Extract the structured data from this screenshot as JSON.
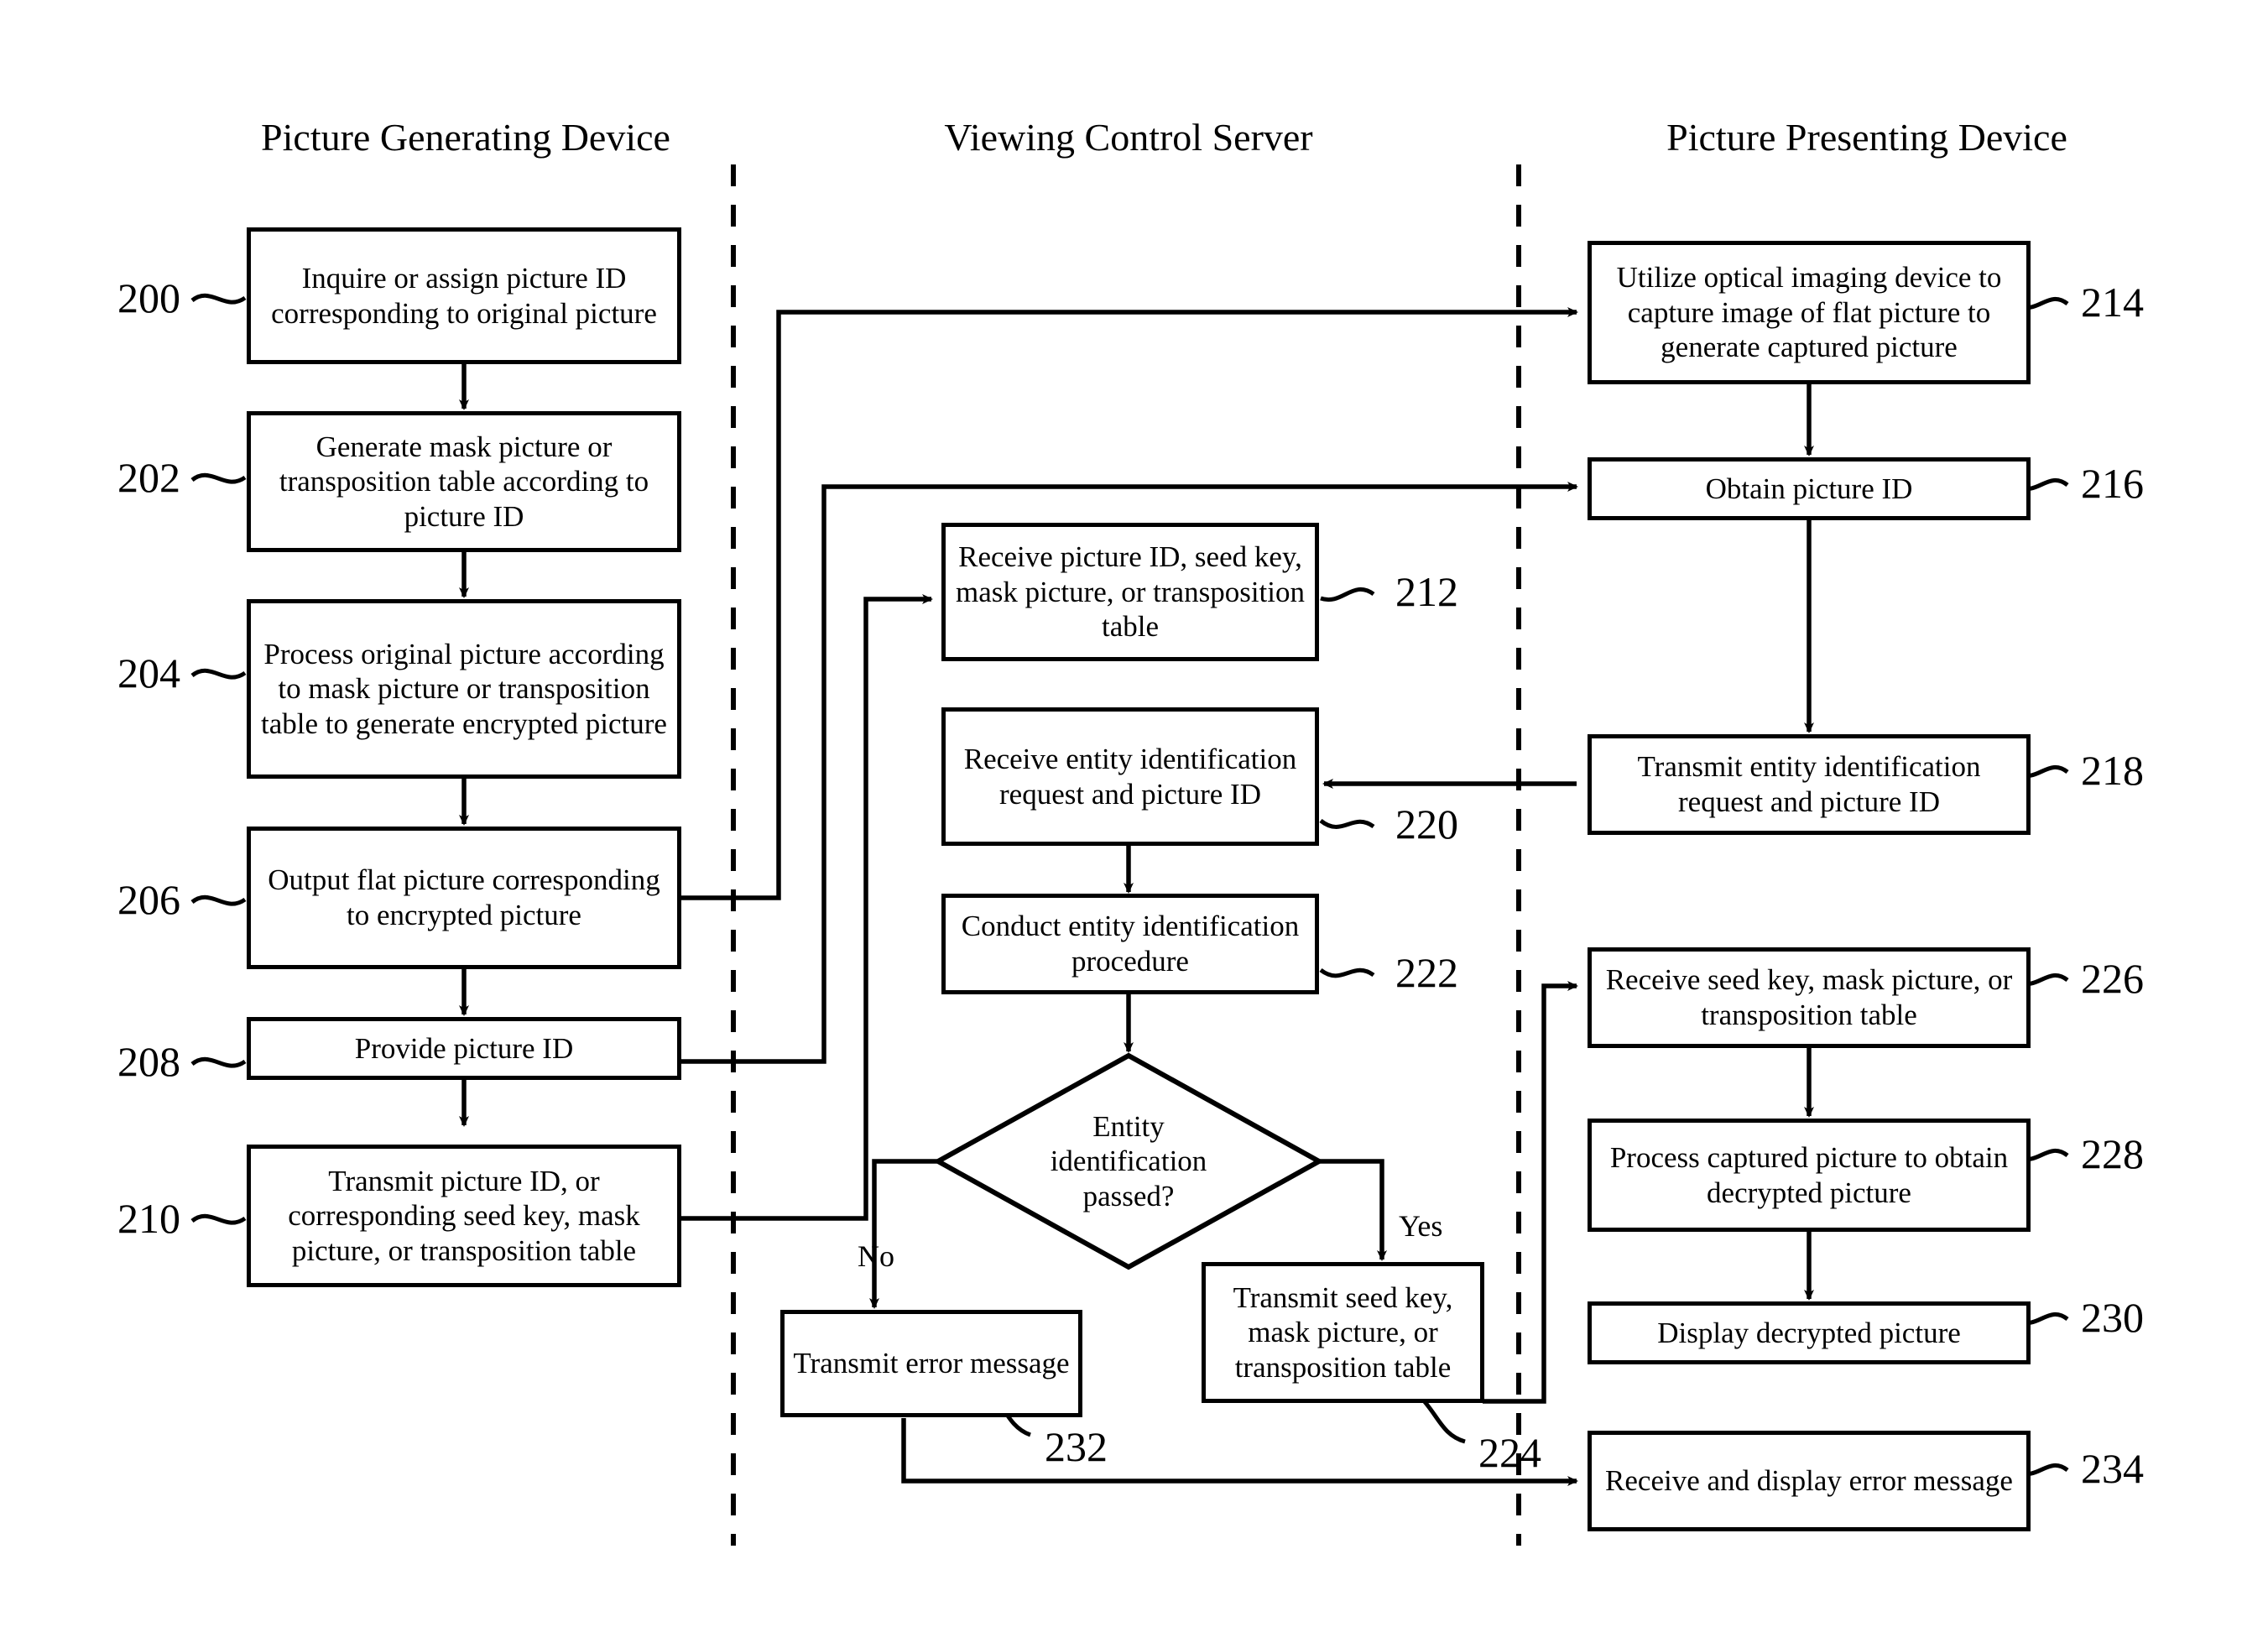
{
  "figure": {
    "lanes": [
      {
        "id": "picture-generating-device",
        "title": "Picture Generating Device"
      },
      {
        "id": "viewing-control-server",
        "title": "Viewing Control Server"
      },
      {
        "id": "picture-presenting-device",
        "title": "Picture Presenting Device"
      }
    ],
    "nodes": [
      {
        "ref": "200",
        "lane": "picture-generating-device",
        "shape": "process",
        "text": "Inquire or assign picture ID corresponding to original picture"
      },
      {
        "ref": "202",
        "lane": "picture-generating-device",
        "shape": "process",
        "text": "Generate mask picture or transposition table according to picture ID"
      },
      {
        "ref": "204",
        "lane": "picture-generating-device",
        "shape": "process",
        "text": "Process original picture according to mask picture or transposition table to generate encrypted picture"
      },
      {
        "ref": "206",
        "lane": "picture-generating-device",
        "shape": "process",
        "text": "Output flat picture corresponding to encrypted picture"
      },
      {
        "ref": "208",
        "lane": "picture-generating-device",
        "shape": "process",
        "text": "Provide picture ID"
      },
      {
        "ref": "210",
        "lane": "picture-generating-device",
        "shape": "process",
        "text": "Transmit picture ID, or corresponding seed key, mask picture, or transposition table"
      },
      {
        "ref": "212",
        "lane": "viewing-control-server",
        "shape": "process",
        "text": "Receive picture ID, seed key, mask picture, or transposition table"
      },
      {
        "ref": "220",
        "lane": "viewing-control-server",
        "shape": "process",
        "text": "Receive entity identification request and picture ID"
      },
      {
        "ref": "222",
        "lane": "viewing-control-server",
        "shape": "process",
        "text": "Conduct entity identification procedure"
      },
      {
        "ref": "",
        "lane": "viewing-control-server",
        "shape": "decision",
        "text": "Entity identification passed?"
      },
      {
        "ref": "232",
        "lane": "viewing-control-server",
        "shape": "process",
        "text": "Transmit error message"
      },
      {
        "ref": "224",
        "lane": "viewing-control-server",
        "shape": "process",
        "text": "Transmit seed key, mask picture, or transposition table"
      },
      {
        "ref": "214",
        "lane": "picture-presenting-device",
        "shape": "process",
        "text": "Utilize optical imaging device to capture image of flat picture to generate captured picture"
      },
      {
        "ref": "216",
        "lane": "picture-presenting-device",
        "shape": "process",
        "text": "Obtain picture ID"
      },
      {
        "ref": "218",
        "lane": "picture-presenting-device",
        "shape": "process",
        "text": "Transmit entity identification request and picture ID"
      },
      {
        "ref": "226",
        "lane": "picture-presenting-device",
        "shape": "process",
        "text": "Receive seed key, mask picture, or transposition table"
      },
      {
        "ref": "228",
        "lane": "picture-presenting-device",
        "shape": "process",
        "text": "Process captured picture to obtain decrypted picture"
      },
      {
        "ref": "230",
        "lane": "picture-presenting-device",
        "shape": "process",
        "text": "Display decrypted picture"
      },
      {
        "ref": "234",
        "lane": "picture-presenting-device",
        "shape": "process",
        "text": "Receive and display error message"
      }
    ],
    "edge_labels": {
      "no": "No",
      "yes": "Yes"
    },
    "colors": {
      "stroke": "#000000",
      "background": "#ffffff"
    }
  }
}
